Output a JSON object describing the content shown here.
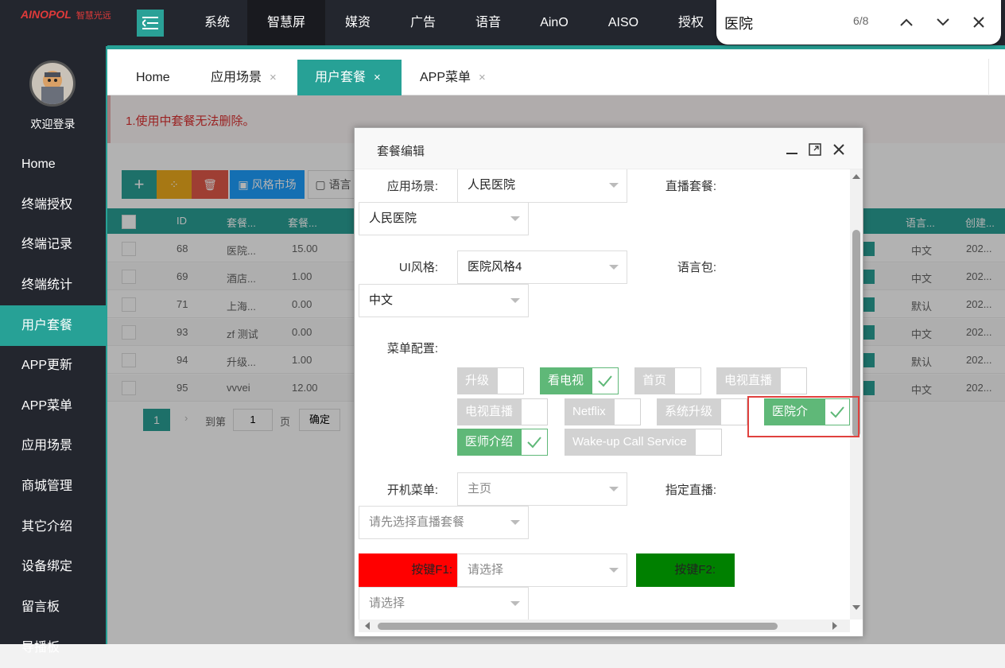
{
  "topbar": {
    "logo_text": "AINOPOL",
    "logo_sub": "智慧光远",
    "nav": [
      "系统",
      "智慧屏",
      "媒资",
      "广告",
      "语音",
      "AinO",
      "AISO",
      "授权"
    ],
    "active_nav": "智慧屏"
  },
  "findbar": {
    "query": "医院",
    "count": "6/8"
  },
  "sidebar": {
    "welcome": "欢迎登录",
    "items": [
      "Home",
      "终端授权",
      "终端记录",
      "终端统计",
      "用户套餐",
      "APP更新",
      "APP菜单",
      "应用场景",
      "商城管理",
      "其它介绍",
      "设备绑定",
      "留言板",
      "导播板"
    ],
    "active": "用户套餐"
  },
  "tabs": [
    {
      "label": "Home"
    },
    {
      "label": "应用场景",
      "close": "×"
    },
    {
      "label": "用户套餐",
      "close": "×"
    },
    {
      "label": "APP菜单",
      "close": "×"
    }
  ],
  "background": {
    "notice": "1.使用中套餐无法删除。",
    "toolbar": {
      "add": "+",
      "style_market": "风格市场",
      "lang": "语言"
    },
    "headers": [
      "ID",
      "套餐...",
      "套餐...",
      "语言...",
      "创建..."
    ],
    "rows": [
      {
        "id": "68",
        "name": "医院...",
        "price": "15.00",
        "lang": "中文",
        "created": "202..."
      },
      {
        "id": "69",
        "name": "酒店...",
        "price": "1.00",
        "lang": "中文",
        "created": "202..."
      },
      {
        "id": "71",
        "name": "上海...",
        "price": "0.00",
        "lang": "默认",
        "created": "202..."
      },
      {
        "id": "93",
        "name": "zf 测试",
        "price": "0.00",
        "lang": "中文",
        "created": "202..."
      },
      {
        "id": "94",
        "name": "升级...",
        "price": "1.00",
        "lang": "默认",
        "created": "202..."
      },
      {
        "id": "95",
        "name": "vvvei",
        "price": "12.00",
        "lang": "中文",
        "created": "202..."
      }
    ],
    "pager": {
      "page": "1",
      "goto_label": "到第",
      "page_input": "1",
      "page_unit": "页",
      "confirm": "确定"
    }
  },
  "dialog": {
    "title": "套餐编辑",
    "scene_label": "应用场景:",
    "scene_value": "人民医院",
    "live_pkg_label": "直播套餐:",
    "live_pkg_value": "人民医院",
    "ui_style_label": "UI风格:",
    "ui_style_value": "医院风格4",
    "lang_pack_label": "语言包:",
    "lang_pack_value": "中文",
    "menu_label": "菜单配置:",
    "menu_items": [
      {
        "label": "升级",
        "checked": false
      },
      {
        "label": "看电视",
        "checked": true
      },
      {
        "label": "首页",
        "checked": false
      },
      {
        "label": "电视直播",
        "checked": false
      },
      {
        "label": "电视直播",
        "checked": false
      },
      {
        "label": "Netflix",
        "checked": false
      },
      {
        "label": "系统升级",
        "checked": false
      },
      {
        "label": "医院介绍",
        "checked": true
      },
      {
        "label": "医师介绍",
        "checked": true
      },
      {
        "label": "Wake-up Call Service",
        "checked": false
      }
    ],
    "boot_menu_label": "开机菜单:",
    "boot_menu_value": "主页",
    "assign_live_label": "指定直播:",
    "assign_live_placeholder": "请先选择直播套餐",
    "f1_label": "按键F1:",
    "f1_placeholder": "请选择",
    "f2_label": "按键F2:",
    "f2_placeholder": "请选择",
    "colors": {
      "f1": "#ff0000",
      "f2": "#008000",
      "checked": "#5fb878"
    }
  },
  "colors": {
    "accent": "#27a196",
    "sidebar_bg": "#23262e",
    "highlight_box": "#e0413e"
  }
}
